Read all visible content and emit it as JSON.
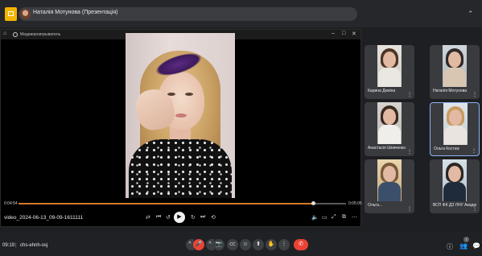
{
  "top_bar": {
    "presenter_label": "Наталія Мотунова (Презентація)",
    "collapse_icon": "chevron-up-icon"
  },
  "media_window": {
    "title": "Медиапроигрыватель",
    "home_icon": "⌂",
    "min_icon": "–",
    "max_icon": "□",
    "close_icon": "✕"
  },
  "player": {
    "time_current": "0:04:54",
    "time_total": "0:05:05",
    "progress": 0.9,
    "file_name": "video_2024-06-13_09-09-1611111",
    "controls": {
      "shuffle": "⇄",
      "prev": "⏮",
      "back": "↺",
      "play": "▶",
      "forward": "↻",
      "next": "⏭",
      "repeat": "⟲",
      "volume": "🔈",
      "cast": "▭",
      "fullscreen": "⤢",
      "miniplayer": "⧉",
      "more": "⋯"
    }
  },
  "participants": [
    {
      "name": "Карина Дюкіна",
      "active": false
    },
    {
      "name": "Наталія Мотунова",
      "active": false
    },
    {
      "name": "Анастасія Шевченко",
      "active": false
    },
    {
      "name": "Ольга Костюк",
      "active": true
    },
    {
      "name": "Ольга...",
      "active": false
    },
    {
      "name": "ВСП ФК ДЗ ЛНУ Академія",
      "active": false
    }
  ],
  "bottom_bar": {
    "time": "09:19",
    "separator": "|",
    "meeting_code": "chs-ehnh-osj",
    "controls": {
      "mic_more": "^",
      "mic": "🎤",
      "cam_more": "^",
      "cam": "📷",
      "captions": "CC",
      "emoji": "☺",
      "present": "⬆",
      "hand": "✋",
      "more": "⋮",
      "end_call": "✆"
    },
    "right": {
      "info": "ⓘ",
      "people": "👥",
      "people_count": "7",
      "chat": "💬"
    }
  },
  "colors": {
    "background": "#1e1f22",
    "accent_seek": "#d47a2a",
    "end_call_red": "#ea4335",
    "active_border": "#8ab4f8"
  }
}
